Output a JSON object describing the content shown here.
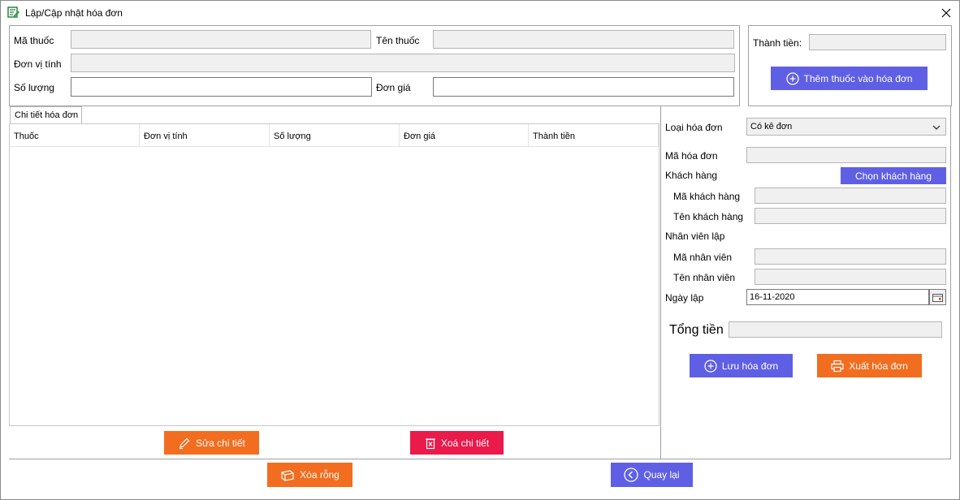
{
  "window": {
    "title": "Lập/Cập nhật hóa đơn",
    "app_icon": "invoice-edit-icon",
    "close_icon": "close-icon"
  },
  "drug_form": {
    "ma_thuoc_label": "Mã thuốc",
    "ten_thuoc_label": "Tên thuốc",
    "don_vi_tinh_label": "Đơn vị tính",
    "so_luong_label": "Số lượng",
    "don_gia_label": "Đơn giá",
    "ma_thuoc_value": "",
    "ten_thuoc_value": "",
    "don_vi_tinh_value": "",
    "so_luong_value": "",
    "don_gia_value": ""
  },
  "subtotal": {
    "label": "Thành tiền:",
    "value": "",
    "add_button": "Thêm thuốc vào hóa đơn",
    "add_icon": "plus-circle-icon"
  },
  "details": {
    "tab_label": "Chi tiết hóa đơn",
    "columns": [
      "Thuốc",
      "Đơn vị tính",
      "Số lượng",
      "Đơn giá",
      "Thành tiền"
    ],
    "rows": [],
    "edit_button": "Sửa chi tiết",
    "edit_icon": "pencil-icon",
    "delete_button": "Xoá chi tiết",
    "delete_icon": "trash-icon"
  },
  "invoice": {
    "loai_label": "Loại hóa đơn",
    "loai_value": "Có kê đơn",
    "ma_hoa_don_label": "Mã hóa đơn",
    "ma_hoa_don_value": "",
    "khach_hang_label": "Khách hàng",
    "chon_khach_hang_button": "Chọn khách hàng",
    "ma_khach_hang_label": "Mã khách hàng",
    "ma_khach_hang_value": "",
    "ten_khach_hang_label": "Tên khách hàng",
    "ten_khach_hang_value": "",
    "nhan_vien_label": "Nhân viên lập",
    "ma_nhan_vien_label": "Mã nhân viên",
    "ma_nhan_vien_value": "",
    "ten_nhan_vien_label": "Tên nhân viên",
    "ten_nhan_vien_value": "",
    "ngay_lap_label": "Ngày lập",
    "ngay_lap_value": "16-11-2020",
    "tong_tien_label": "Tổng tiền",
    "tong_tien_value": "",
    "save_button": "Lưu hóa đơn",
    "save_icon": "plus-circle-icon",
    "print_button": "Xuất hóa đơn",
    "print_icon": "printer-icon"
  },
  "footer": {
    "clear_button": "Xóa rỗng",
    "clear_icon": "eraser-icon",
    "back_button": "Quay lại",
    "back_icon": "chevron-left-circle-icon"
  },
  "colors": {
    "primary_button": "#5f5fe6",
    "accent_orange": "#f26d1f",
    "danger_red": "#ea1a4b"
  }
}
